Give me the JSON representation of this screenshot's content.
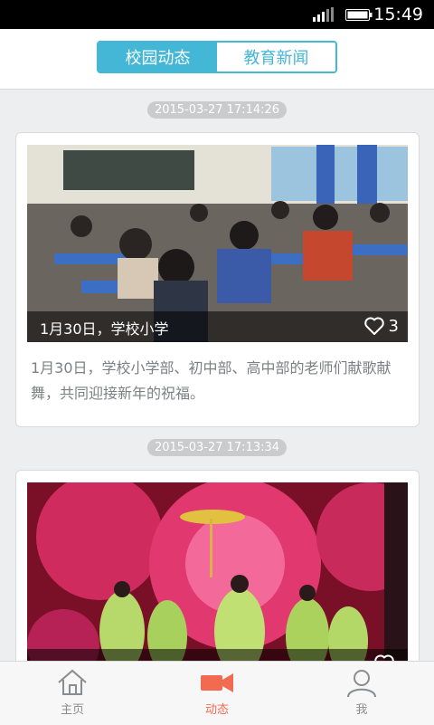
{
  "status_bar": {
    "time": "15:49"
  },
  "tabs": [
    {
      "label": "校园动态",
      "active": true
    },
    {
      "label": "教育新闻",
      "active": false
    }
  ],
  "posts": [
    {
      "timestamp": "2015-03-27 17:14:26",
      "caption": "1月30日，学校小学",
      "likes": "3",
      "description": "1月30日，学校小学部、初中部、高中部的老师们献歌献舞，共同迎接新年的祝福。"
    },
    {
      "timestamp": "2015-03-27 17:13:34",
      "caption": "",
      "likes": ""
    }
  ],
  "bottom_nav": [
    {
      "label": "主页",
      "icon": "home-icon",
      "active": false
    },
    {
      "label": "动态",
      "icon": "video-camera-icon",
      "active": true
    },
    {
      "label": "我",
      "icon": "person-icon",
      "active": false
    }
  ],
  "colors": {
    "accent": "#44b6d6",
    "nav_active": "#f26a4f"
  }
}
